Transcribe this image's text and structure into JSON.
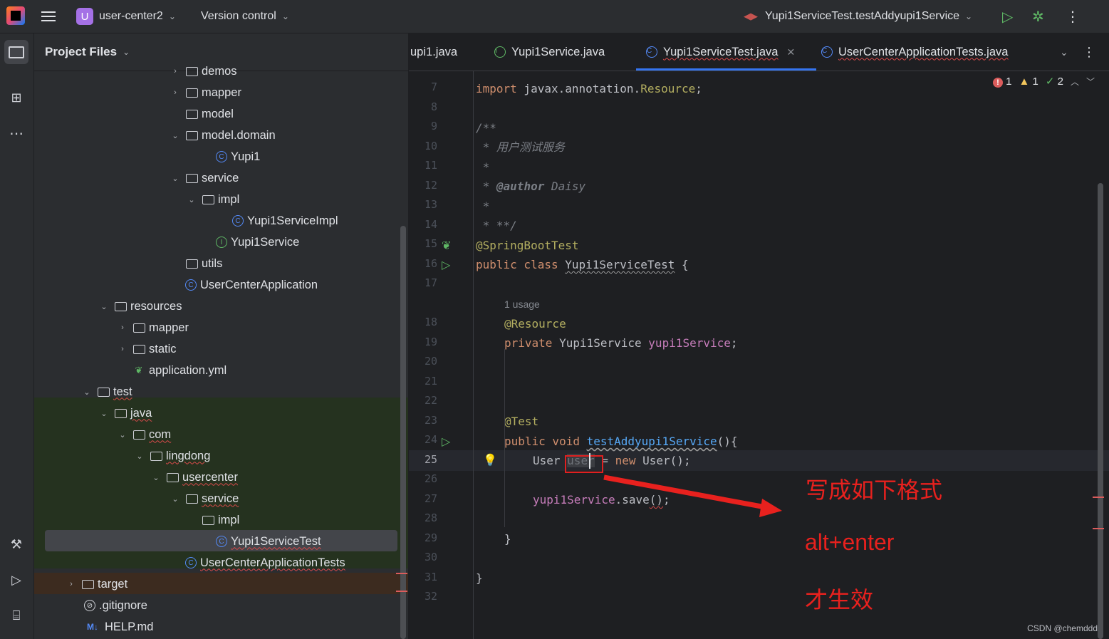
{
  "titlebar": {
    "project_initial": "U",
    "project_name": "user-center2",
    "version_control": "Version control",
    "run_config": "Yupi1ServiceTest.testAddyupi1Service"
  },
  "project_panel": {
    "title": "Project Files",
    "items": [
      {
        "label": "demos",
        "icon": "package-icon",
        "arrow": "›"
      },
      {
        "label": "mapper",
        "icon": "package-icon",
        "arrow": "›"
      },
      {
        "label": "model",
        "icon": "package-icon",
        "arrow": ""
      },
      {
        "label": "model.domain",
        "icon": "package-icon",
        "arrow": "⌄"
      },
      {
        "label": "Yupi1",
        "icon": "class-icon",
        "arrow": ""
      },
      {
        "label": "service",
        "icon": "package-icon",
        "arrow": "⌄"
      },
      {
        "label": "impl",
        "icon": "package-icon",
        "arrow": "⌄"
      },
      {
        "label": "Yupi1ServiceImpl",
        "icon": "class-icon",
        "arrow": ""
      },
      {
        "label": "Yupi1Service",
        "icon": "interface-icon",
        "arrow": ""
      },
      {
        "label": "utils",
        "icon": "package-icon",
        "arrow": ""
      },
      {
        "label": "UserCenterApplication",
        "icon": "spring-class-icon",
        "arrow": ""
      },
      {
        "label": "resources",
        "icon": "resources-folder-icon",
        "arrow": "⌄"
      },
      {
        "label": "mapper",
        "icon": "folder-icon",
        "arrow": "›"
      },
      {
        "label": "static",
        "icon": "folder-icon",
        "arrow": "›"
      },
      {
        "label": "application.yml",
        "icon": "yaml-icon",
        "arrow": ""
      },
      {
        "label": "test",
        "icon": "folder-icon",
        "arrow": "⌄"
      },
      {
        "label": "java",
        "icon": "test-folder-icon",
        "arrow": "⌄"
      },
      {
        "label": "com",
        "icon": "package-icon",
        "arrow": "⌄"
      },
      {
        "label": "lingdong",
        "icon": "package-icon",
        "arrow": "⌄"
      },
      {
        "label": "usercenter",
        "icon": "package-icon",
        "arrow": "⌄"
      },
      {
        "label": "service",
        "icon": "package-icon",
        "arrow": "⌄"
      },
      {
        "label": "impl",
        "icon": "package-icon",
        "arrow": ""
      },
      {
        "label": "Yupi1ServiceTest",
        "icon": "class-icon",
        "arrow": ""
      },
      {
        "label": "UserCenterApplicationTests",
        "icon": "class-icon",
        "arrow": ""
      },
      {
        "label": "target",
        "icon": "folder-icon",
        "arrow": "›"
      },
      {
        "label": ".gitignore",
        "icon": "ignore-file-icon",
        "arrow": ""
      },
      {
        "label": "HELP.md",
        "icon": "markdown-icon",
        "arrow": ""
      }
    ]
  },
  "editor": {
    "tabs": [
      {
        "label": "upi1.java",
        "icon": ""
      },
      {
        "label": "Yupi1Service.java",
        "icon": "interface-icon"
      },
      {
        "label": "Yupi1ServiceTest.java",
        "icon": "class-icon",
        "active": true
      },
      {
        "label": "UserCenterApplicationTests.java",
        "icon": "class-icon"
      }
    ],
    "indicators": {
      "errors": "1",
      "warnings": "1",
      "weak_warnings": "2"
    },
    "line_numbers": [
      "7",
      "8",
      "9",
      "10",
      "11",
      "12",
      "13",
      "14",
      "15",
      "16",
      "17",
      "18",
      "19",
      "20",
      "21",
      "22",
      "23",
      "24",
      "25",
      "26",
      "27",
      "28",
      "29",
      "30",
      "31",
      "32"
    ],
    "code": {
      "l7_kw": "import",
      "l7_rest": " javax.annotation.",
      "l7_cls": "Resource",
      "l7_end": ";",
      "l9": "/**",
      "l10": " * 用户测试服务",
      "l11": " *",
      "l12_star": " * ",
      "l12_tag": "@author",
      "l12_name": " Daisy",
      "l13": " *",
      "l14": " * **/",
      "l15": "@SpringBootTest",
      "l16_kw": "public class ",
      "l16_name": "Yupi1ServiceTest",
      "l16_end": " {",
      "usage_hint": "1 usage",
      "l18": "@Resource",
      "l19_kw": "private ",
      "l19_type": "Yupi1Service ",
      "l19_field": "yupi1Service",
      "l19_end": ";",
      "l23": "@Test",
      "l24_kw": "public void ",
      "l24_fn": "testAddyupi1Service",
      "l24_end": "(){",
      "l25_type": "User ",
      "l25_var": "user",
      "l25_eq": " = ",
      "l25_new": "new ",
      "l25_end": "User();",
      "l27_field": "yupi1Service",
      "l27_call": ".save",
      "l27_paren": "()",
      "l27_end": ";",
      "l29": "}",
      "l31": "}"
    }
  },
  "annotations": {
    "note1": "写成如下格式",
    "note2": "alt+enter",
    "note3": "才生效"
  },
  "watermark": "CSDN @chemddd",
  "colors": {
    "accent": "#3574f0",
    "annotation_red": "#e8211e",
    "error": "#db5c5c"
  }
}
